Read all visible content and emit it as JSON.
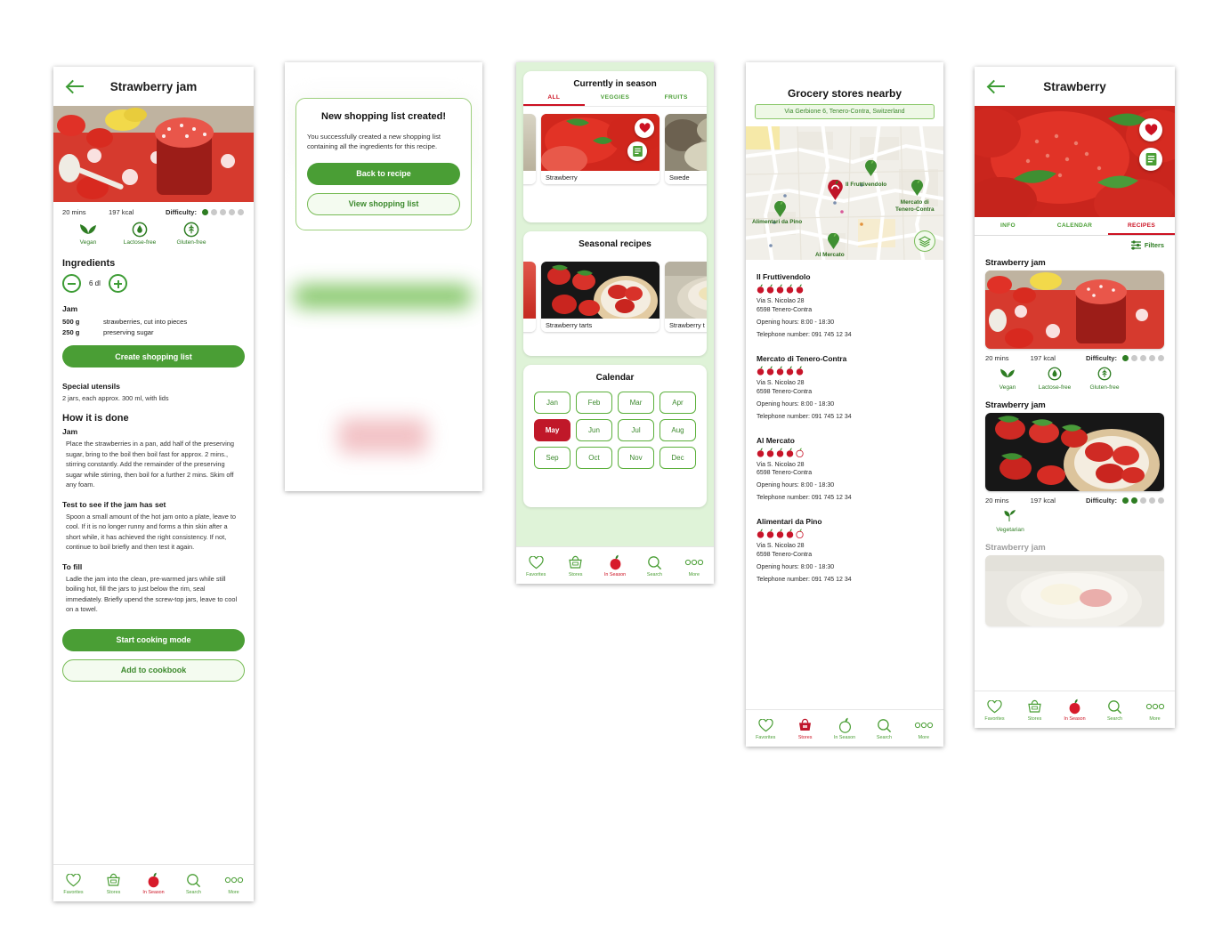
{
  "screens": {
    "recipe": {
      "header": {
        "title": "Strawberry jam",
        "back_icon": "back-arrow-icon"
      },
      "meta": {
        "time": "20 mins",
        "calories": "197 kcal",
        "difficulty_label": "Difficulty:",
        "difficulty_value": 1,
        "difficulty_max": 5
      },
      "diet_badges": [
        {
          "label": "Vegan",
          "icon": "leaf-icon"
        },
        {
          "label": "Lactose-free",
          "icon": "lactose-free-icon"
        },
        {
          "label": "Gluten-free",
          "icon": "gluten-free-icon"
        }
      ],
      "ingredients_heading": "Ingredients",
      "portion": {
        "value": "6 dl",
        "minus": "minus-icon",
        "plus": "plus-icon"
      },
      "group_title": "Jam",
      "ingredients": [
        {
          "amount": "500 g",
          "name": "strawberries, cut into pieces"
        },
        {
          "amount": "250 g",
          "name": "preserving sugar"
        }
      ],
      "create_list_button": "Create shopping list",
      "utensils_heading": "Special utensils",
      "utensils_text": "2 jars, each approx. 300 ml, with lids",
      "howto_heading": "How it is done",
      "steps": [
        {
          "title": "Jam",
          "text": "Place the strawberries in a pan, add half of the preserving sugar, bring to the boil then boil fast for approx. 2 mins., stirring constantly. Add the remainder of the preserving sugar while stirring, then boil for a further 2 mins. Skim off any foam."
        },
        {
          "title": "Test to see if the jam has set",
          "text": "Spoon a small amount of the hot jam onto a plate, leave to cool. If it is no longer runny and forms a thin skin after a short while, it has achieved the right consistency. If not, continue to boil briefly and then test it again."
        },
        {
          "title": "To fill",
          "text": "Ladle the jam into the clean, pre-warmed jars while still boiling hot, fill the jars to just below the rim, seal immediately. Briefly upend the screw-top jars, leave to cool on a towel."
        }
      ],
      "start_cooking_button": "Start cooking mode",
      "add_cookbook_button": "Add to cookbook"
    },
    "shopping_modal": {
      "title": "New shopping list created!",
      "body": "You successfully created a new shopping list containing all the ingredients for this recipe.",
      "primary_button": "Back to recipe",
      "secondary_button": "View shopping list"
    },
    "in_season": {
      "season_card": {
        "title": "Currently in season",
        "tabs": [
          {
            "label": "ALL",
            "active": true
          },
          {
            "label": "VEGGIES",
            "active": false
          },
          {
            "label": "FRUITS",
            "active": false
          }
        ],
        "tiles": [
          {
            "caption": "Strawberry",
            "favorite_icon": "heart-filled-icon",
            "list_icon": "shopping-list-icon"
          },
          {
            "caption": "Swede"
          }
        ]
      },
      "recipes_card": {
        "title": "Seasonal recipes",
        "tiles": [
          {
            "caption": "Strawberry tarts"
          },
          {
            "caption": "Strawberry t"
          }
        ]
      },
      "calendar_card": {
        "title": "Calendar",
        "months": [
          "Jan",
          "Feb",
          "Mar",
          "Apr",
          "May",
          "Jun",
          "Jul",
          "Aug",
          "Sep",
          "Oct",
          "Nov",
          "Dec"
        ],
        "active_month": "May"
      }
    },
    "stores": {
      "title": "Grocery stores nearby",
      "address": "Via Gerbione 6, Tenero-Contra, Switzerland",
      "map": {
        "layers_icon": "map-layers-icon",
        "pins": [
          {
            "label": "Il Fruttivendolo",
            "type": "store"
          },
          {
            "label": "Mercato di Tenero-Contra",
            "type": "store"
          },
          {
            "label": "Alimentari da Pino",
            "type": "store"
          },
          {
            "label": "Al Mercato",
            "type": "store"
          },
          {
            "label": "",
            "type": "current-location"
          }
        ]
      },
      "list": [
        {
          "name": "Il Fruttivendolo",
          "rating": 5,
          "rating_max": 5,
          "street": "Via S. Nicolao 28",
          "city": "6598 Tenero-Contra",
          "hours": "Opening hours: 8:00 - 18:30",
          "phone": "Telephone number: 091 745 12 34"
        },
        {
          "name": "Mercato di Tenero-Contra",
          "rating": 5,
          "rating_max": 5,
          "street": "Via S. Nicolao 28",
          "city": "6598 Tenero-Contra",
          "hours": "Opening hours: 8:00 - 18:30",
          "phone": "Telephone number: 091 745 12 34"
        },
        {
          "name": "Al Mercato",
          "rating": 4,
          "rating_max": 5,
          "street": "Via S. Nicolao 28",
          "city": "6598 Tenero-Contra",
          "hours": "Opening hours: 8:00 - 18:30",
          "phone": "Telephone number: 091 745 12 34"
        },
        {
          "name": "Alimentari da Pino",
          "rating": 4,
          "rating_max": 5,
          "street": "Via S. Nicolao 28",
          "city": "6598 Tenero-Contra",
          "hours": "Opening hours: 8:00 - 18:30",
          "phone": "Telephone number: 091 745 12 34"
        }
      ]
    },
    "product": {
      "header": {
        "title": "Strawberry",
        "back_icon": "back-arrow-icon"
      },
      "hero_actions": [
        {
          "icon": "heart-filled-icon",
          "name": "favorite-button"
        },
        {
          "icon": "shopping-list-icon",
          "name": "add-to-list-button"
        }
      ],
      "tabs": [
        {
          "label": "INFO",
          "active": false
        },
        {
          "label": "CALENDAR",
          "active": false
        },
        {
          "label": "RECIPES",
          "active": true
        }
      ],
      "filters_label": "Filters",
      "filters_icon": "filters-icon",
      "recipes": [
        {
          "title": "Strawberry jam",
          "time": "20 mins",
          "calories": "197 kcal",
          "difficulty_label": "Difficulty:",
          "difficulty": 1,
          "difficulty_max": 5,
          "badges": [
            {
              "label": "Vegan",
              "icon": "leaf-icon"
            },
            {
              "label": "Lactose-free",
              "icon": "lactose-free-icon"
            },
            {
              "label": "Gluten-free",
              "icon": "gluten-free-icon"
            }
          ]
        },
        {
          "title": "Strawberry jam",
          "time": "20 mins",
          "calories": "197 kcal",
          "difficulty_label": "Difficulty:",
          "difficulty": 2,
          "difficulty_max": 5,
          "badges": [
            {
              "label": "Vegetarian",
              "icon": "sprout-icon"
            }
          ]
        },
        {
          "title": "Strawberry jam"
        }
      ]
    }
  },
  "bottom_nav": {
    "items": [
      {
        "label": "Favorites",
        "icon": "heart-icon"
      },
      {
        "label": "Stores",
        "icon": "basket-icon"
      },
      {
        "label": "In Season",
        "icon": "apple-icon"
      },
      {
        "label": "Search",
        "icon": "magnifier-icon"
      },
      {
        "label": "More",
        "icon": "ellipsis-icon"
      }
    ],
    "active_recipe": "In Season",
    "active_in_season": "In Season",
    "active_stores": "Stores",
    "active_product": "In Season"
  },
  "colors": {
    "green": "#4a9e35",
    "dark_green": "#2e7d23",
    "red": "#cc1122",
    "crimson": "#c01829",
    "light_green_bg": "#dff3d8",
    "pale_green": "#f4fbf0"
  }
}
